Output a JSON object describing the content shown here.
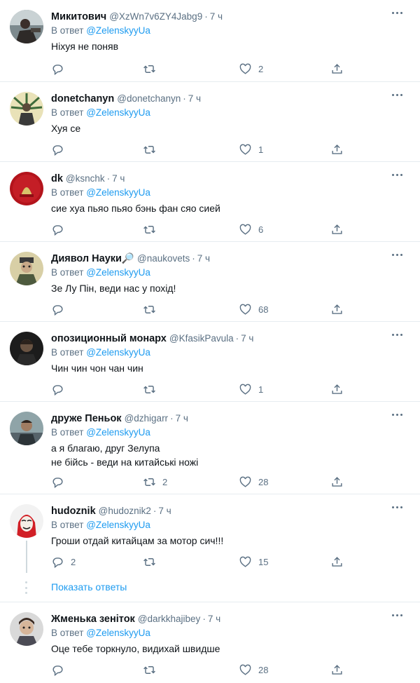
{
  "reply_prefix": "В ответ",
  "tweets": [
    {
      "name": "Микитович",
      "handle": "@XzWn7v6ZY4Jabg9",
      "time": "7 ч",
      "reply_to": "@ZelenskyyUa",
      "text": "Ніхуя не поняв",
      "replies": "",
      "retweets": "",
      "likes": "2"
    },
    {
      "name": "donetchanyn",
      "handle": "@donetchanyn",
      "time": "7 ч",
      "reply_to": "@ZelenskyyUa",
      "text": "Хуя се",
      "replies": "",
      "retweets": "",
      "likes": "1"
    },
    {
      "name": "dk",
      "handle": "@ksnchk",
      "time": "7 ч",
      "reply_to": "@ZelenskyyUa",
      "text": "сие хуа пьяо пьяо бэнь фан сяо сией",
      "replies": "",
      "retweets": "",
      "likes": "6"
    },
    {
      "name": "Диявол Науки🔎",
      "handle": "@naukovets",
      "time": "7 ч",
      "reply_to": "@ZelenskyyUa",
      "text": "Зе Лу Пін, веди нас у похід!",
      "replies": "",
      "retweets": "",
      "likes": "68"
    },
    {
      "name": "опозиционный монарх",
      "handle": "@KfasikPavula",
      "time": "7 ч",
      "reply_to": "@ZelenskyyUa",
      "text": "Чин чин чон чан чин",
      "replies": "",
      "retweets": "",
      "likes": "1"
    },
    {
      "name": "друже Пеньок",
      "handle": "@dzhigarr",
      "time": "7 ч",
      "reply_to": "",
      "text": "а я благаю, друг Зелупа\nне бійсь - веди на китайські ножі",
      "replies": "",
      "retweets": "2",
      "likes": "28"
    },
    {
      "name": "hudoznik",
      "handle": "@hudoznik2",
      "time": "7 ч",
      "reply_to": "@ZelenskyyUa",
      "text": "Гроши отдай китайцам за мотор сич!!!",
      "replies": "2",
      "retweets": "",
      "likes": "15",
      "show_replies": "Показать ответы"
    },
    {
      "name": "Жменька зеніток",
      "handle": "@darkkhajibey",
      "time": "7 ч",
      "reply_to": "@ZelenskyyUa",
      "text": "Оце тебе торкнуло, видихай швидше",
      "replies": "",
      "retweets": "",
      "likes": "28"
    }
  ],
  "colors": {
    "accent": "#1d9bf0",
    "muted": "#5b7083",
    "divider": "#e6ecf0"
  },
  "icons": {
    "reply": "reply-icon",
    "retweet": "retweet-icon",
    "like": "heart-icon",
    "share": "share-icon",
    "more": "more-icon"
  }
}
